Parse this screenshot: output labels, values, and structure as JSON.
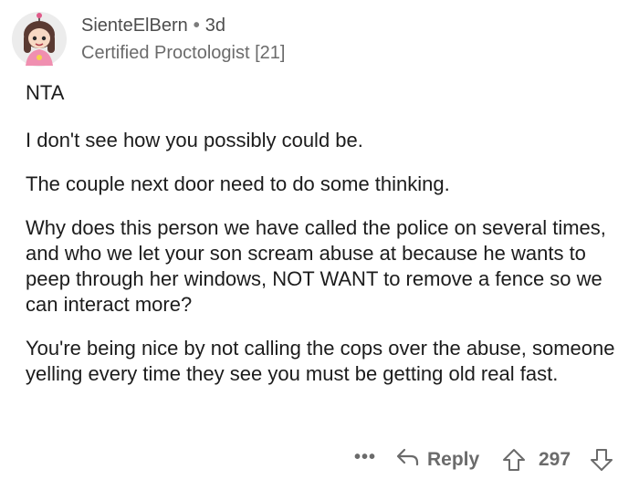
{
  "comment": {
    "author": "SienteElBern",
    "separator": "•",
    "time": "3d",
    "flair": "Certified Proctologist [21]",
    "paragraphs": [
      "NTA",
      "I don't see how you possibly could be.",
      "The couple next door need to do some thinking.",
      "Why does this person we have called the police on several times, and who we let your son scream abuse at because he wants to peep through her windows, NOT WANT to remove a fence so we can interact more?",
      "You're being nice by not calling the cops over the abuse, someone yelling every time they see you must be getting old real fast."
    ],
    "actions": {
      "more_label": "•••",
      "reply_label": "Reply",
      "score": "297"
    }
  },
  "icons": {
    "more": "more-icon",
    "reply": "reply-arrow-icon",
    "upvote": "upvote-arrow-icon",
    "downvote": "downvote-arrow-icon"
  },
  "colors": {
    "text": "#1c1c1c",
    "meta": "#4d4d4d",
    "muted": "#6b6b6b",
    "avatar_bg": "#e9e9e9"
  }
}
